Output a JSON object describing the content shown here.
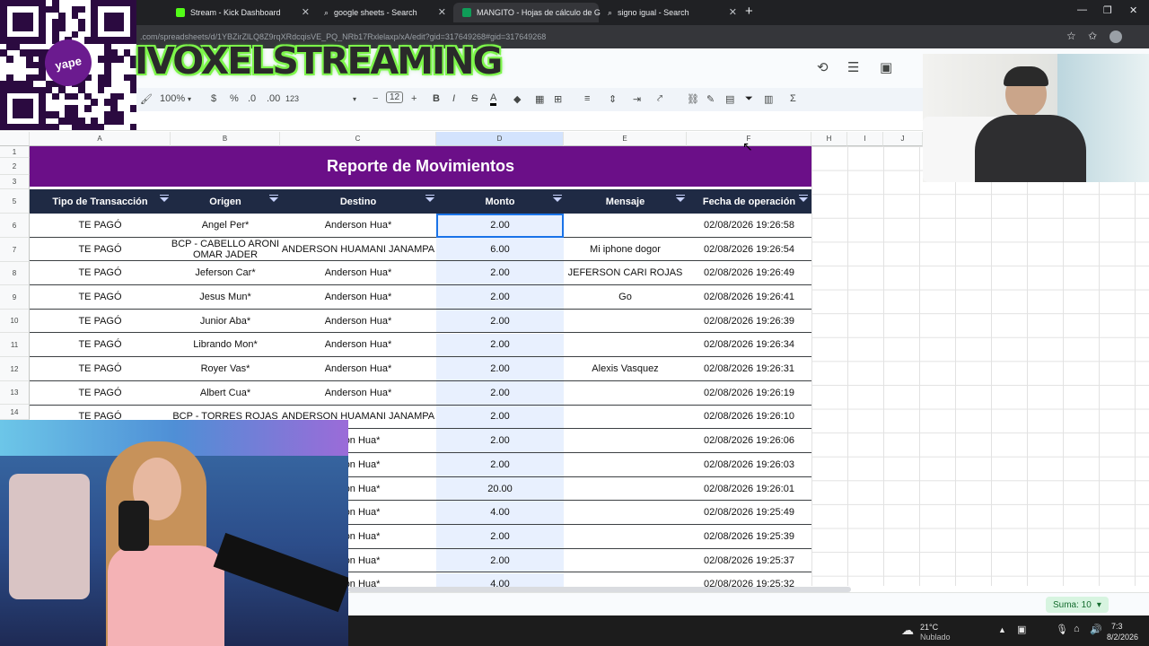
{
  "browser": {
    "tabs": [
      {
        "label": "Stream - Kick Dashboard"
      },
      {
        "label": "google sheets - Search"
      },
      {
        "label": "MANGITO - Hojas de cálculo de G"
      },
      {
        "label": "signo igual - Search"
      }
    ],
    "url": ".com/spreadsheets/d/1YBZirZlLQ8Z9rqXRdcqisVE_PQ_NRb17Rxlelaxp/xA/edit?gid=317649268#gid=317649268"
  },
  "overlay": {
    "brand_text": "IVOXELSTREAMING",
    "qr_badge_text": "yape"
  },
  "toolbar": {
    "zoom": "100%",
    "currency": "$",
    "percent": "%",
    "dec_less": ".0",
    "dec_more": ".00",
    "number_format": "123",
    "font_size": "12",
    "minus": "−",
    "plus": "+",
    "bold": "B",
    "italic": "I",
    "strike": "S",
    "text_color": "A",
    "sum": "Σ"
  },
  "columns": [
    "A",
    "B",
    "C",
    "D",
    "E",
    "F",
    "H",
    "I",
    "J"
  ],
  "row_numbers": [
    "1",
    "2",
    "3",
    "5",
    "6",
    "7",
    "8",
    "9",
    "10",
    "11",
    "12",
    "13",
    "14"
  ],
  "report": {
    "title": "Reporte de Movimientos",
    "headers": [
      "Tipo de Transacción",
      "Origen",
      "Destino",
      "Monto",
      "Mensaje",
      "Fecha de operación"
    ],
    "rows": [
      [
        "TE PAGÓ",
        "Angel Per*",
        "Anderson Hua*",
        "2.00",
        "",
        "02/08/2026 19:26:58"
      ],
      [
        "TE PAGÓ",
        "BCP - CABELLO ARONI OMAR JADER",
        "ANDERSON HUAMANI JANAMPA",
        "6.00",
        "Mi iphone dogor",
        "02/08/2026 19:26:54"
      ],
      [
        "TE PAGÓ",
        "Jeferson Car*",
        "Anderson Hua*",
        "2.00",
        "JEFERSON CARI ROJAS",
        "02/08/2026 19:26:49"
      ],
      [
        "TE PAGÓ",
        "Jesus Mun*",
        "Anderson Hua*",
        "2.00",
        "Go",
        "02/08/2026 19:26:41"
      ],
      [
        "TE PAGÓ",
        "Junior Aba*",
        "Anderson Hua*",
        "2.00",
        "",
        "02/08/2026 19:26:39"
      ],
      [
        "TE PAGÓ",
        "Librando Mon*",
        "Anderson Hua*",
        "2.00",
        "",
        "02/08/2026 19:26:34"
      ],
      [
        "TE PAGÓ",
        "Royer Vas*",
        "Anderson Hua*",
        "2.00",
        "Alexis Vasquez",
        "02/08/2026 19:26:31"
      ],
      [
        "TE PAGÓ",
        "Albert Cua*",
        "Anderson Hua*",
        "2.00",
        "",
        "02/08/2026 19:26:19"
      ],
      [
        "TE PAGÓ",
        "BCP - TORRES ROJAS",
        "ANDERSON HUAMANI JANAMPA",
        "2.00",
        "",
        "02/08/2026 19:26:10"
      ],
      [
        "",
        "",
        "rson Hua*",
        "2.00",
        "",
        "02/08/2026 19:26:06"
      ],
      [
        "",
        "",
        "rson Hua*",
        "2.00",
        "",
        "02/08/2026 19:26:03"
      ],
      [
        "",
        "",
        "rson Hua*",
        "20.00",
        "",
        "02/08/2026 19:26:01"
      ],
      [
        "",
        "",
        "rson Hua*",
        "4.00",
        "",
        "02/08/2026 19:25:49"
      ],
      [
        "",
        "",
        "rson Hua*",
        "2.00",
        "",
        "02/08/2026 19:25:39"
      ],
      [
        "",
        "",
        "rson Hua*",
        "2.00",
        "",
        "02/08/2026 19:25:37"
      ],
      [
        "",
        "",
        "rson Hua*",
        "4.00",
        "",
        "02/08/2026 19:25:32"
      ]
    ]
  },
  "status": {
    "sum_label": "Suma: 10"
  },
  "taskbar": {
    "temp": "21°C",
    "weather": "Nublado",
    "time": "7:3",
    "date": "8/2/2026"
  },
  "colors": {
    "title_bg": "#6b0f88",
    "header_bg": "#1f2a44",
    "selection": "#1a73e8",
    "brand_glow": "#7df64a"
  }
}
